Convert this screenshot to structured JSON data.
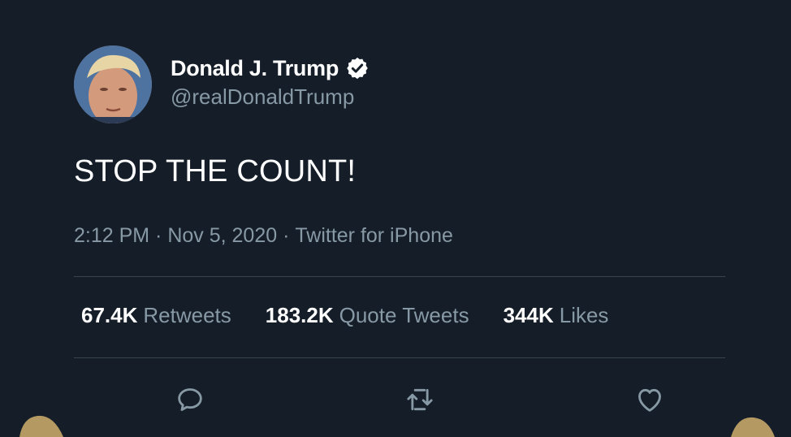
{
  "user": {
    "display_name": "Donald J. Trump",
    "handle": "@realDonaldTrump",
    "verified": true
  },
  "tweet": {
    "text": "STOP THE COUNT!",
    "time": "2:12 PM",
    "separator": " · ",
    "date": "Nov 5, 2020",
    "source": "Twitter for iPhone"
  },
  "stats": [
    {
      "count": "67.4K",
      "label": "Retweets"
    },
    {
      "count": "183.2K",
      "label": "Quote Tweets"
    },
    {
      "count": "344K",
      "label": "Likes"
    }
  ],
  "icons": {
    "reply": "reply-icon",
    "retweet": "retweet-icon",
    "like": "heart-icon",
    "verified": "verified-badge-icon"
  },
  "colors": {
    "background": "#141d28",
    "secondary_text": "#8899a6",
    "divider": "#38444d"
  }
}
